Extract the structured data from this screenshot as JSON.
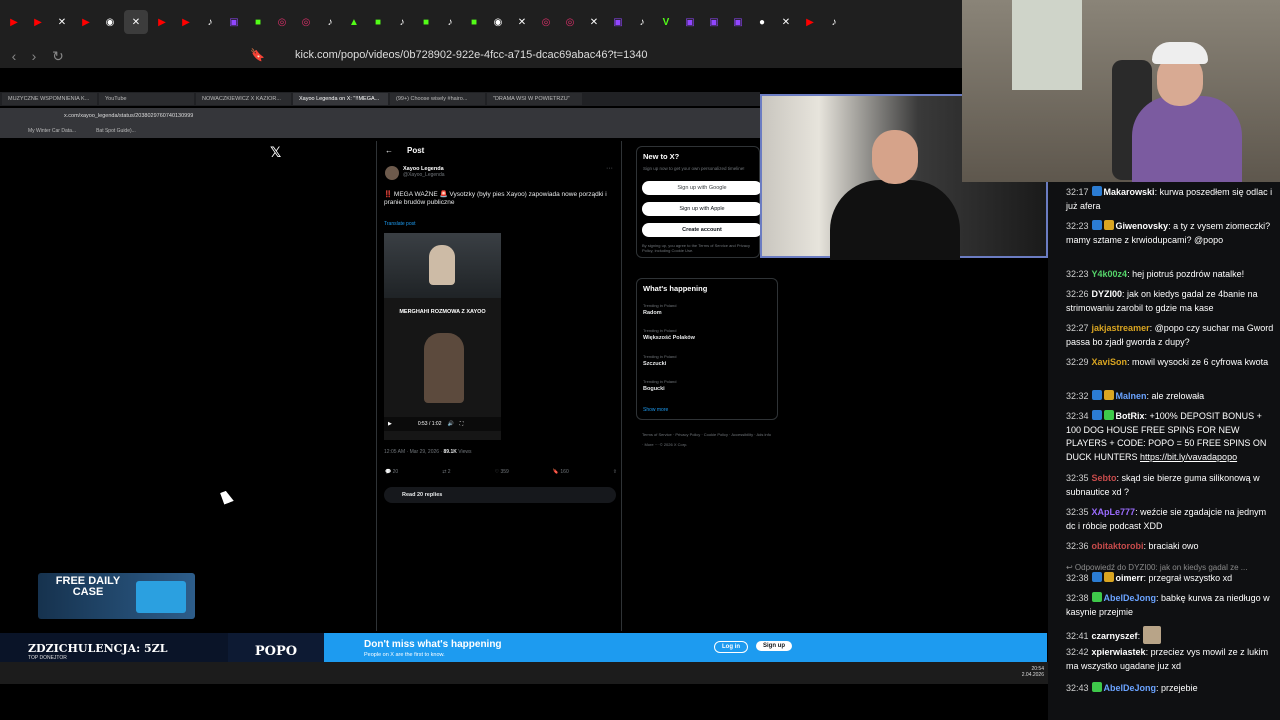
{
  "outer_browser": {
    "url": "kick.com/popo/videos/0b728902-922e-4fcc-a715-dcac69abac46?t=1340",
    "tab_icons": [
      "yt",
      "yt",
      "x",
      "yt",
      "chrome",
      "x",
      "yt",
      "yt",
      "tt",
      "tw",
      "gr",
      "ig",
      "ig",
      "tt",
      "drive",
      "gr",
      "tt",
      "gr",
      "tt",
      "gr",
      "chrome",
      "x",
      "ig",
      "ig",
      "x",
      "tw",
      "tt",
      "v",
      "tw",
      "tw",
      "tw",
      "chat",
      "x",
      "yt",
      "tt"
    ]
  },
  "inner_browser": {
    "tabs": [
      "MUZYCZNE WSPOMNIENIA K...",
      "YouTube",
      "NOWACZKIEWICZ X KAZIOR...",
      "Xayoo Legenda on X: \"!!MEGA...",
      "(99+) Choose wisely #hairo...",
      "\"DRAMA WSI W POWIETRZU\""
    ],
    "url": "x.com/xayoo_legenda/status/2038029760740130999",
    "bookmarks": [
      "My Winter Car Data...",
      "Bat Spot Guide)..."
    ]
  },
  "post": {
    "header": "Post",
    "author_name": "Xayoo Legenda",
    "author_handle": "@Xayoo_Legenda",
    "text": "‼️ MEGA WAŻNE 🚨 Vysotzky (były pies Xayoo) zapowiada nowe porządki i pranie brudów publiczne",
    "translate": "Translate post",
    "video_title": "MERGHAHI ROZMOWA Z XAYOO",
    "video_time": "0:53 / 1:02",
    "meta_time": "12:05 AM · Mar 29, 2026",
    "meta_views": "89.1K",
    "meta_views_label": "Views",
    "replies": "20",
    "reposts": "2",
    "likes": "359",
    "bookmarks": "160",
    "read_replies": "Read 20 replies"
  },
  "sidebar": {
    "new_title": "New to X?",
    "new_sub": "Sign up now to get your own personalized timeline!",
    "google_btn": "Sign up with Google",
    "apple_btn": "Sign up with Apple",
    "create_btn": "Create account",
    "legal": "By signing up, you agree to the Terms of Service and Privacy Policy, including Cookie Use.",
    "trends_title": "What's happening",
    "trends": [
      {
        "label": "Trending in Poland",
        "name": "Radom"
      },
      {
        "label": "Trending in Poland",
        "name": "Większość Polaków"
      },
      {
        "label": "Trending in Poland",
        "name": "Szczucki"
      },
      {
        "label": "Trending in Poland",
        "name": "Bogucki"
      }
    ],
    "show_more": "Show more",
    "footer": "Terms of Service · Privacy Policy · Cookie Policy · Accessibility · Ads info · More ··· © 2026 X Corp."
  },
  "overlays": {
    "daily_case": "FREE DAILY CASE",
    "donate_label": "ZDZICHULENCJA: 5ZL",
    "donate_sub": "TOP DONEJTOR",
    "channel": "POPO",
    "banner_title": "Don't miss what's happening",
    "banner_sub": "People on X are the first to know.",
    "login": "Log in",
    "signup": "Sign up",
    "clock_time": "20:54",
    "clock_date": "2.04.2026"
  },
  "chat": [
    {
      "ts": "32:17",
      "user": "Makarowski",
      "color": "#ffffff",
      "badges": [
        "blue"
      ],
      "text": ": kurwa poszedłem się odlac i już afera"
    },
    {
      "ts": "32:23",
      "user": "Giwenovsky",
      "color": "#ffffff",
      "badges": [
        "blue",
        "gold"
      ],
      "text": ": a ty z vysem ziomeczki? mamy sztame z krwiodupcami? @popo"
    },
    {
      "ts": "32:23",
      "user": "Y4k00z4",
      "color": "#55d46a",
      "badges": [],
      "text": ": hej piotruś pozdrów natalke!"
    },
    {
      "ts": "32:26",
      "user": "DYZI00",
      "color": "#ffffff",
      "badges": [],
      "text": ": jak on kiedys gadal ze 4banie na strimowaniu zarobil to gdzie ma kase"
    },
    {
      "ts": "32:27",
      "user": "jakjastreamer",
      "color": "#d9a521",
      "badges": [],
      "text": ": @popo czy suchar ma Gword passa bo zjadł gworda z dupy?"
    },
    {
      "ts": "32:29",
      "user": "XaviSon",
      "color": "#d9a521",
      "badges": [],
      "text": ": mowil wysocki ze 6 cyfrowa kwota"
    },
    {
      "ts": "32:32",
      "user": "Malnen",
      "color": "#6aa3ff",
      "badges": [
        "blue",
        "gold"
      ],
      "text": ": ale zrelowała"
    },
    {
      "ts": "32:34",
      "user": "BotRix",
      "color": "#ffffff",
      "badges": [
        "blue",
        "green"
      ],
      "text": ": +100% DEPOSIT BONUS + 100 DOG HOUSE FREE SPINS FOR NEW PLAYERS + CODE: POPO = 50 FREE SPINS ON DUCK HUNTERS ",
      "link": "https://bit.ly/vavadapopo"
    },
    {
      "ts": "32:35",
      "user": "Sebto",
      "color": "#c74b4b",
      "badges": [],
      "text": ": skąd sie bierze guma silikonową w subnautice xd ?"
    },
    {
      "ts": "32:35",
      "user": "XApLe777",
      "color": "#9b6cff",
      "badges": [],
      "text": ": weźcie sie zgadajcie na jednym dc i róbcie podcast XDD"
    },
    {
      "ts": "32:36",
      "user": "obitaktorobi",
      "color": "#c74b4b",
      "badges": [],
      "text": ": braciaki owo"
    },
    {
      "ts": "32:38",
      "user": "oimerr",
      "color": "#ffffff",
      "badges": [
        "blue",
        "gold"
      ],
      "text": ": przegrał wszystko xd"
    },
    {
      "ts": "32:38",
      "user": "AbelDeJong",
      "color": "#6aa3ff",
      "badges": [
        "green"
      ],
      "text": ": babkę kurwa za niedługo w kasynie przejmie"
    },
    {
      "ts": "32:41",
      "user": "czarnyszef",
      "color": "#ffffff",
      "badges": [],
      "text": ": "
    },
    {
      "ts": "32:42",
      "user": "xpierwiastek",
      "color": "#ffffff",
      "badges": [],
      "text": ": przeciez vys mowil ze z lukim ma wszystko ugadane juz xd"
    },
    {
      "ts": "32:43",
      "user": "AbelDeJong",
      "color": "#6aa3ff",
      "badges": [
        "green"
      ],
      "text": ": przejebie"
    }
  ],
  "chat_reply_ref": "↩ Odpowiedź do DYZI00: jak on kiedys gadal ze ..."
}
